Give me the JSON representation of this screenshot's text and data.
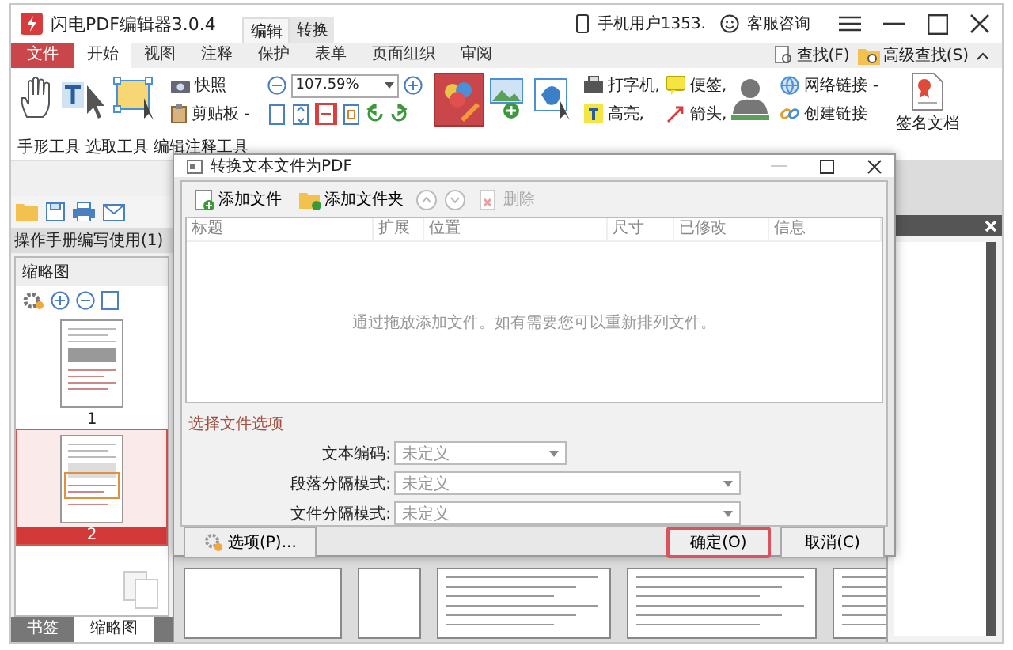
{
  "window": {
    "title": "闪电PDF编辑器3.0.4",
    "mode_tabs": [
      {
        "label": "编辑",
        "selected": true
      },
      {
        "label": "转换",
        "selected": false
      }
    ],
    "user": "手机用户1353.",
    "support": "客服咨询"
  },
  "menu": [
    {
      "label": "文件",
      "kind": "file",
      "selected": false
    },
    {
      "label": "开始",
      "kind": "tab",
      "selected": true
    },
    {
      "label": "视图",
      "kind": "tab",
      "selected": false
    },
    {
      "label": "注释",
      "kind": "tab",
      "selected": false
    },
    {
      "label": "保护",
      "kind": "tab",
      "selected": false
    },
    {
      "label": "表单",
      "kind": "tab",
      "selected": false
    },
    {
      "label": "页面组织",
      "kind": "tab",
      "selected": false
    },
    {
      "label": "审阅",
      "kind": "tab",
      "selected": false
    }
  ],
  "search": {
    "find": "查找(F)",
    "advanced": "高级查找(S)"
  },
  "ribbon": {
    "tools": [
      "手形工具",
      "选取工具",
      "编辑注释工具"
    ],
    "snapshot": "快照",
    "clipboard": "剪贴板 -",
    "zoom": "107.59%",
    "markup": [
      "打字机,",
      "便签,",
      "高亮,",
      "箭头,"
    ],
    "links": [
      "网络链接 -",
      "创建链接"
    ],
    "sign": "签名文档"
  },
  "left_panel": {
    "doc_tab": "操作手册编写使用(1)",
    "title": "缩略图",
    "thumbnails": [
      {
        "label": "1",
        "selected": false
      },
      {
        "label": "2",
        "selected": true
      }
    ],
    "bottom_tabs": [
      {
        "label": "书签",
        "selected": false
      },
      {
        "label": "缩略图",
        "selected": true
      }
    ]
  },
  "dialog": {
    "title": "转换文本文件为PDF",
    "toolbar": [
      {
        "label": "添加文件",
        "disabled": false
      },
      {
        "label": "添加文件夹",
        "disabled": false
      },
      {
        "label": "删除",
        "disabled": true
      }
    ],
    "columns": [
      "标题",
      "扩展",
      "位置",
      "尺寸",
      "已修改",
      "信息"
    ],
    "empty_hint": "通过拖放添加文件。如有需要您可以重新排列文件。",
    "options_title": "选择文件选项",
    "fields": [
      {
        "label": "文本编码:",
        "value": "未定义"
      },
      {
        "label": "段落分隔模式:",
        "value": "未定义"
      },
      {
        "label": "文件分隔模式:",
        "value": "未定义"
      }
    ],
    "options_button": "选项(P)...",
    "ok_button": "确定(O)",
    "cancel_button": "取消(C)"
  }
}
